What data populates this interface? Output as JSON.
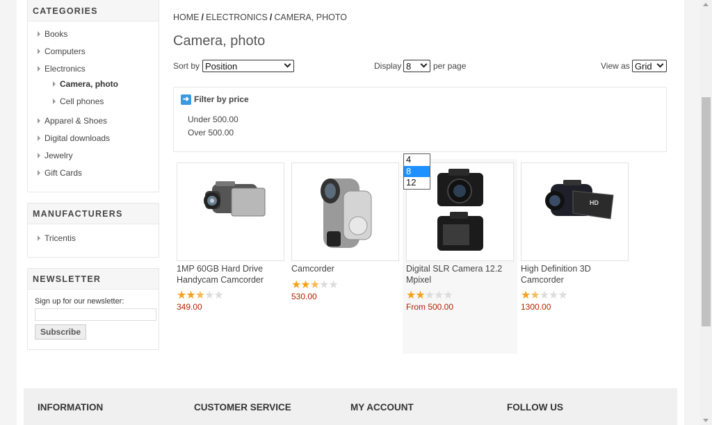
{
  "sidebar": {
    "categories": {
      "title": "CATEGORIES",
      "items": [
        "Books",
        "Computers",
        "Electronics"
      ],
      "subitems": [
        "Camera, photo",
        "Cell phones"
      ],
      "items_after": [
        "Apparel & Shoes",
        "Digital downloads",
        "Jewelry",
        "Gift Cards"
      ]
    },
    "manufacturers": {
      "title": "MANUFACTURERS",
      "items": [
        "Tricentis"
      ]
    },
    "newsletter": {
      "title": "NEWSLETTER",
      "label": "Sign up for our newsletter:",
      "input_value": "",
      "button": "Subscribe"
    }
  },
  "breadcrumb": [
    "HOME",
    "ELECTRONICS",
    "CAMERA, PHOTO"
  ],
  "breadcrumb_sep": "/",
  "page_title": "Camera, photo",
  "sort": {
    "label": "Sort by",
    "value": "Position"
  },
  "display": {
    "label": "Display",
    "value": "8",
    "suffix": "per page",
    "options": [
      "4",
      "8",
      "12"
    ],
    "highlighted": "8"
  },
  "view": {
    "label": "View as",
    "value": "Grid"
  },
  "filter": {
    "title": "Filter by price",
    "icon": "arrow-right-icon",
    "options": [
      "Under 500.00",
      "Over 500.00"
    ]
  },
  "products": [
    {
      "name": "1MP 60GB Hard Drive Handycam Camcorder",
      "rating": 2.5,
      "price": "349.00",
      "image": "camcorder-silver"
    },
    {
      "name": "Camcorder",
      "rating": 2.5,
      "price": "530.00",
      "image": "camcorder-vertical"
    },
    {
      "name": "Digital SLR Camera 12.2 Mpixel",
      "rating": 2,
      "price": "From 500.00",
      "image": "dslr-camera"
    },
    {
      "name": "High Definition 3D Camcorder",
      "rating": 1.5,
      "price": "1300.00",
      "image": "camcorder-hd-black"
    }
  ],
  "footer": {
    "headings": [
      "INFORMATION",
      "CUSTOMER SERVICE",
      "MY ACCOUNT",
      "FOLLOW US"
    ]
  },
  "colors": {
    "price": "#b51f00",
    "star": "#f5a21b",
    "accent": "#3a9ae0"
  }
}
